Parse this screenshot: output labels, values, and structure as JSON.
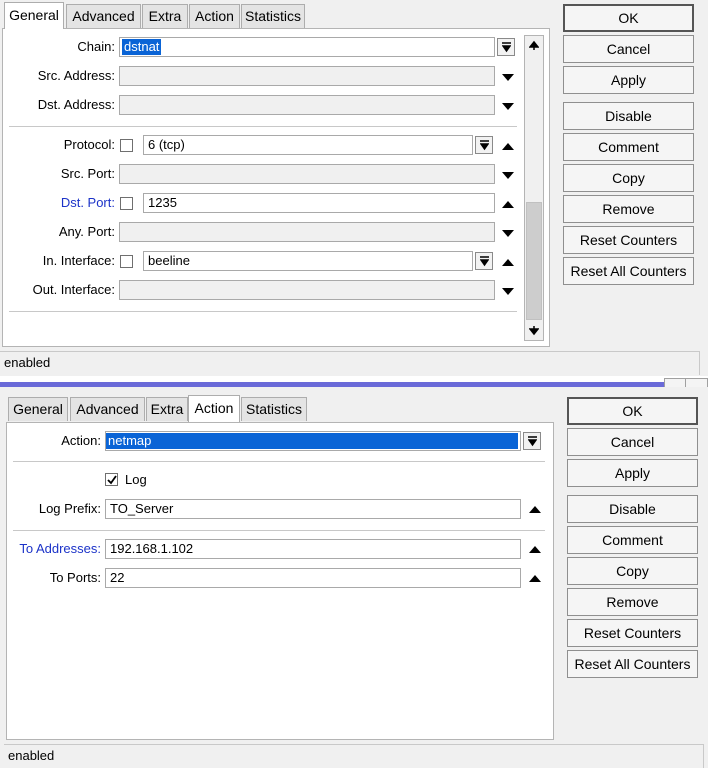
{
  "window1": {
    "tabs": [
      {
        "label": "General",
        "active": true
      },
      {
        "label": "Advanced",
        "active": false
      },
      {
        "label": "Extra",
        "active": false
      },
      {
        "label": "Action",
        "active": false
      },
      {
        "label": "Statistics",
        "active": false
      }
    ],
    "fields": {
      "chain": {
        "label": "Chain:",
        "value": "dstnat"
      },
      "src_address": {
        "label": "Src. Address:",
        "value": ""
      },
      "dst_address": {
        "label": "Dst. Address:",
        "value": ""
      },
      "protocol": {
        "label": "Protocol:",
        "value": "6 (tcp)"
      },
      "src_port": {
        "label": "Src. Port:",
        "value": ""
      },
      "dst_port": {
        "label": "Dst. Port:",
        "value": "1235"
      },
      "any_port": {
        "label": "Any. Port:",
        "value": ""
      },
      "in_interface": {
        "label": "In. Interface:",
        "value": "beeline"
      },
      "out_interface": {
        "label": "Out. Interface:",
        "value": ""
      }
    },
    "buttons": {
      "ok": "OK",
      "cancel": "Cancel",
      "apply": "Apply",
      "disable": "Disable",
      "comment": "Comment",
      "copy": "Copy",
      "remove": "Remove",
      "reset_counters": "Reset Counters",
      "reset_all_counters": "Reset All Counters"
    },
    "status": "enabled"
  },
  "window2": {
    "tabs": [
      {
        "label": "General",
        "active": false
      },
      {
        "label": "Advanced",
        "active": false
      },
      {
        "label": "Extra",
        "active": false
      },
      {
        "label": "Action",
        "active": true
      },
      {
        "label": "Statistics",
        "active": false
      }
    ],
    "fields": {
      "action": {
        "label": "Action:",
        "value": "netmap"
      },
      "log": {
        "label": "Log",
        "checked": true
      },
      "log_prefix": {
        "label": "Log Prefix:",
        "value": "TO_Server"
      },
      "to_addresses": {
        "label": "To Addresses:",
        "value": "192.168.1.102"
      },
      "to_ports": {
        "label": "To Ports:",
        "value": "22"
      }
    },
    "buttons": {
      "ok": "OK",
      "cancel": "Cancel",
      "apply": "Apply",
      "disable": "Disable",
      "comment": "Comment",
      "copy": "Copy",
      "remove": "Remove",
      "reset_counters": "Reset Counters",
      "reset_all_counters": "Reset All Counters"
    },
    "status": "enabled"
  },
  "colors": {
    "accent_blue_label": "#1c33c8",
    "selection": "#0a64d6",
    "window_strip": "#6a6ad8"
  },
  "icons": {
    "dropdown": "dropdown-arrow-icon",
    "expand": "triangle-down-icon",
    "collapse": "triangle-up-icon",
    "checkmark": "checkmark-icon"
  }
}
